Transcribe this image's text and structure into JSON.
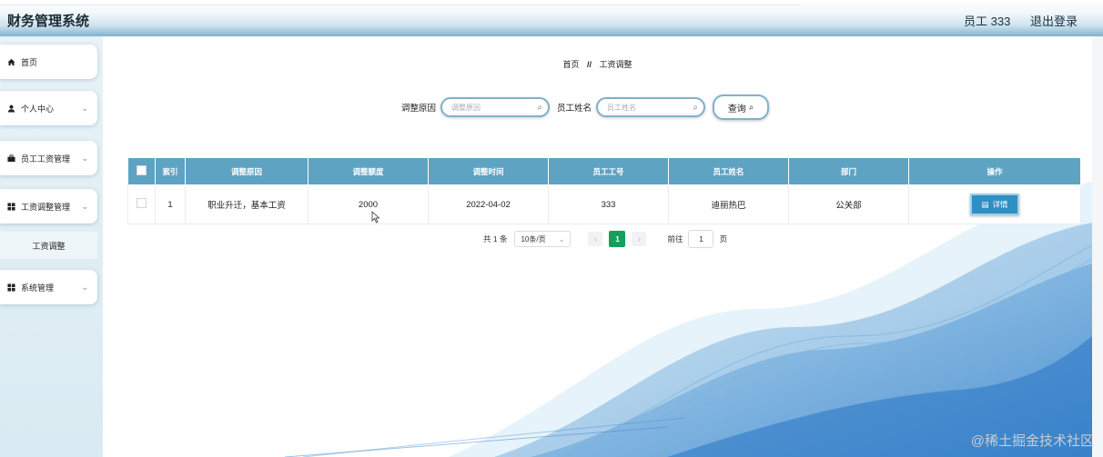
{
  "app": {
    "title": "财务管理系统"
  },
  "header": {
    "user": "员工 333",
    "logout": "退出登录"
  },
  "sidebar": {
    "items": [
      {
        "label": "首页",
        "icon": "home-icon",
        "chevron": ""
      },
      {
        "label": "个人中心",
        "icon": "user-icon",
        "chevron": "⌄"
      },
      {
        "label": "员工工资管理",
        "icon": "briefcase-icon",
        "chevron": "⌄"
      },
      {
        "label": "工资调整管理",
        "icon": "grid-icon",
        "chevron": "⌄"
      },
      {
        "label": "系统管理",
        "icon": "grid-icon",
        "chevron": "⌄"
      }
    ],
    "subitem": "工资调整"
  },
  "breadcrumb": {
    "home": "首页",
    "sep": "//",
    "current": "工资调整"
  },
  "search": {
    "reason_label": "调整原因",
    "reason_placeholder": "调整原因",
    "name_label": "员工姓名",
    "name_placeholder": "员工姓名",
    "query_button": "查询"
  },
  "table": {
    "headers": [
      "索引",
      "调整原因",
      "调整额度",
      "调整时间",
      "员工工号",
      "员工姓名",
      "部门",
      "操作"
    ],
    "rows": [
      {
        "index": "1",
        "reason": "职业升迁，基本工资",
        "amount": "2000",
        "time": "2022-04-02",
        "emp_no": "333",
        "emp_name": "迪丽热巴",
        "dept": "公关部",
        "action": "详情"
      }
    ]
  },
  "pager": {
    "total": "共 1 条",
    "size": "10条/页",
    "current": "1",
    "goto_label": "前往",
    "goto_value": "1",
    "page_unit": "页"
  },
  "watermark": "@稀土掘金技术社区",
  "colors": {
    "header_th": "#5ea3c2",
    "accent": "#2f8fc0",
    "pager_current": "#13a05a"
  }
}
